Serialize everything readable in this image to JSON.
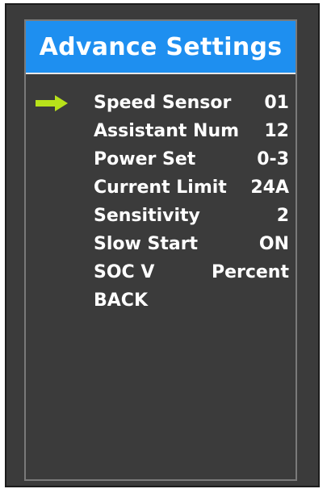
{
  "header": {
    "title": "Advance Settings"
  },
  "menu": {
    "selected_index": 0,
    "items": [
      {
        "label": "Speed  Sensor",
        "value": "01"
      },
      {
        "label": "Assistant  Num",
        "value": "12"
      },
      {
        "label": "Power  Set",
        "value": "0-3"
      },
      {
        "label": "Current Limit",
        "value": "24A"
      },
      {
        "label": "Sensitivity",
        "value": "2"
      },
      {
        "label": "Slow Start",
        "value": "ON"
      },
      {
        "label": "SOC V",
        "value": "Percent"
      },
      {
        "label": "BACK",
        "value": ""
      }
    ]
  },
  "icons": {
    "selector": "arrow-right-icon"
  },
  "colors": {
    "title_bar": "#1e8ff0",
    "screen_bg": "#3b3b3b",
    "text": "#ffffff",
    "selector": "#b8e21a"
  }
}
